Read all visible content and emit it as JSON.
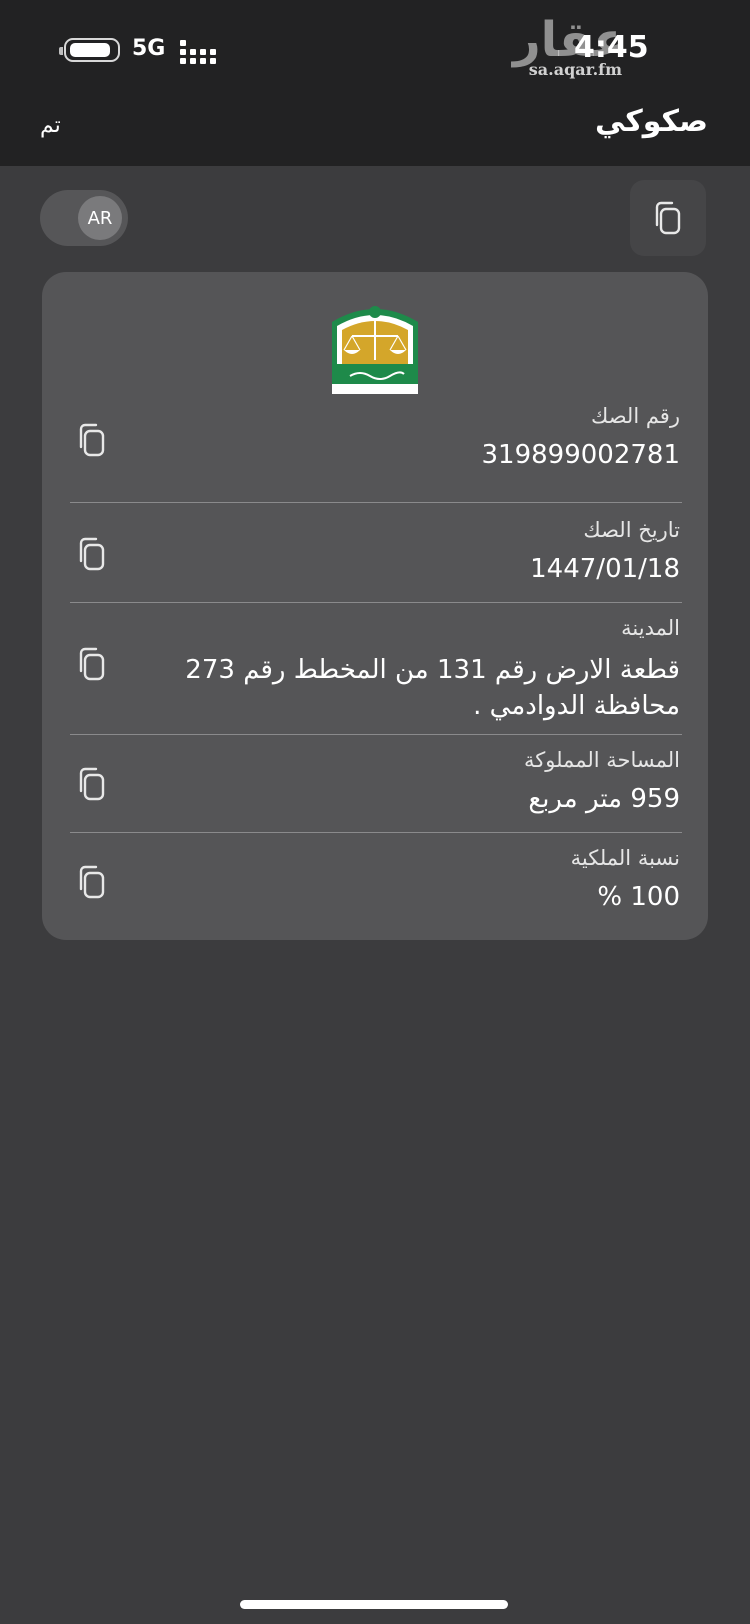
{
  "status": {
    "network": "5G",
    "time": "4:45",
    "watermark_logo": "عقار",
    "watermark_url": "sa.aqar.fm"
  },
  "nav": {
    "title": "صكوكي",
    "done_label": "تم"
  },
  "toolbar": {
    "lang_label": "AR",
    "copy_all_icon": "copy-icon"
  },
  "deed": {
    "emblem_icon": "ministry-of-justice-emblem",
    "fields": [
      {
        "label": "رقم الصك",
        "value": "319899002781"
      },
      {
        "label": "تاريخ الصك",
        "value": "1447/01/18"
      },
      {
        "label": "المدينة",
        "value_line1": "قطعة الارض  رقم 131 من المخطط رقم  273",
        "value_line2": "محافظة الدوادمي ."
      },
      {
        "label": "المساحة المملوكة",
        "value": "959 متر مربع"
      },
      {
        "label": "نسبة الملكية",
        "value": "100 %"
      }
    ]
  },
  "colors": {
    "background": "#3c3c3e",
    "header": "#222223",
    "card": "#555557",
    "emblem_green": "#1e8a4a",
    "emblem_gold": "#d4a62a"
  }
}
